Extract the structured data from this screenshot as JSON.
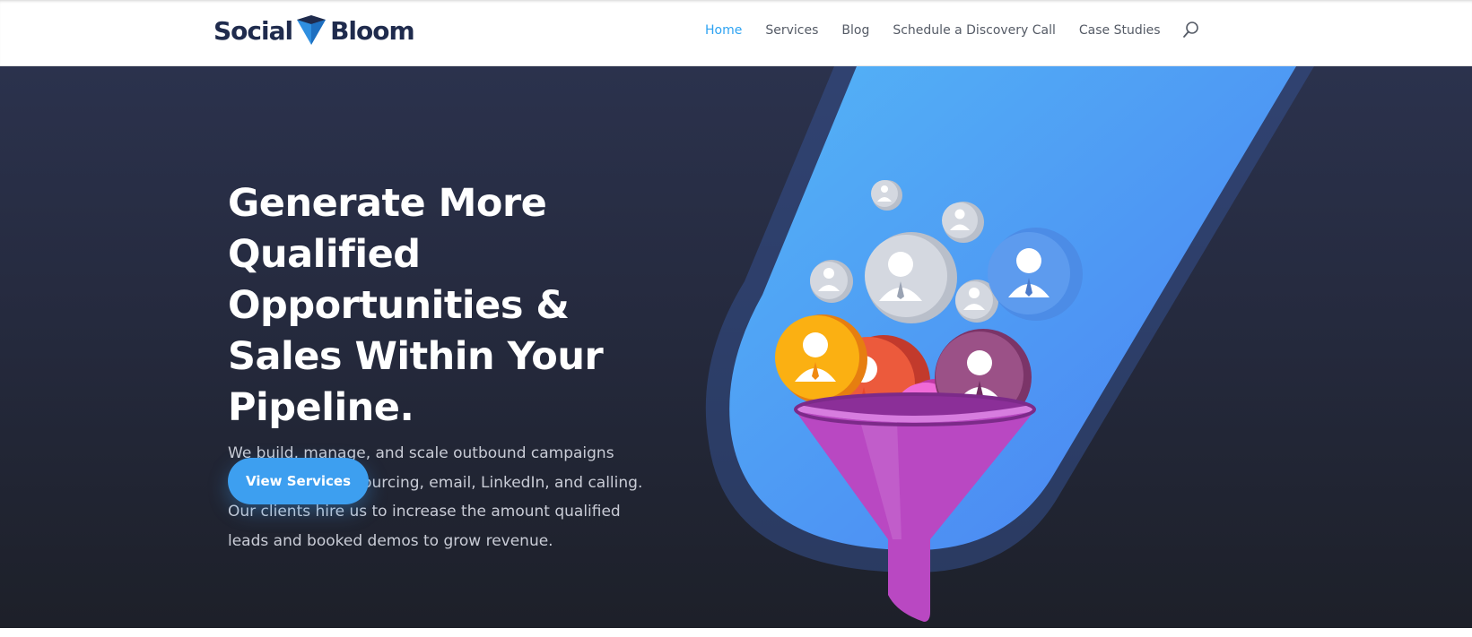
{
  "header": {
    "logo": {
      "word1": "Social",
      "word2": "Bloom",
      "mark_icon": "diamond-logo-icon"
    },
    "nav": [
      {
        "label": "Home",
        "active": true
      },
      {
        "label": "Services",
        "active": false
      },
      {
        "label": "Blog",
        "active": false
      },
      {
        "label": "Schedule a Discovery Call",
        "active": false
      },
      {
        "label": "Case Studies",
        "active": false
      }
    ],
    "search_icon": "search-icon"
  },
  "hero": {
    "headline": "Generate More Qualified Opportunities & Sales Within Your Pipeline.",
    "subtext": "We build, manage, and scale outbound campaigns through contact sourcing, email, LinkedIn, and calling. Our clients hire us to increase the amount qualified leads and booked demos to grow revenue.",
    "cta_label": "View Services",
    "illustration": "lead-funnel-illustration"
  },
  "colors": {
    "accent": "#2ea3f2",
    "button": "#3d9ff0",
    "hero_bg": "#252a3e",
    "logo_navy": "#1f2b4d",
    "funnel": "#b948c2"
  }
}
